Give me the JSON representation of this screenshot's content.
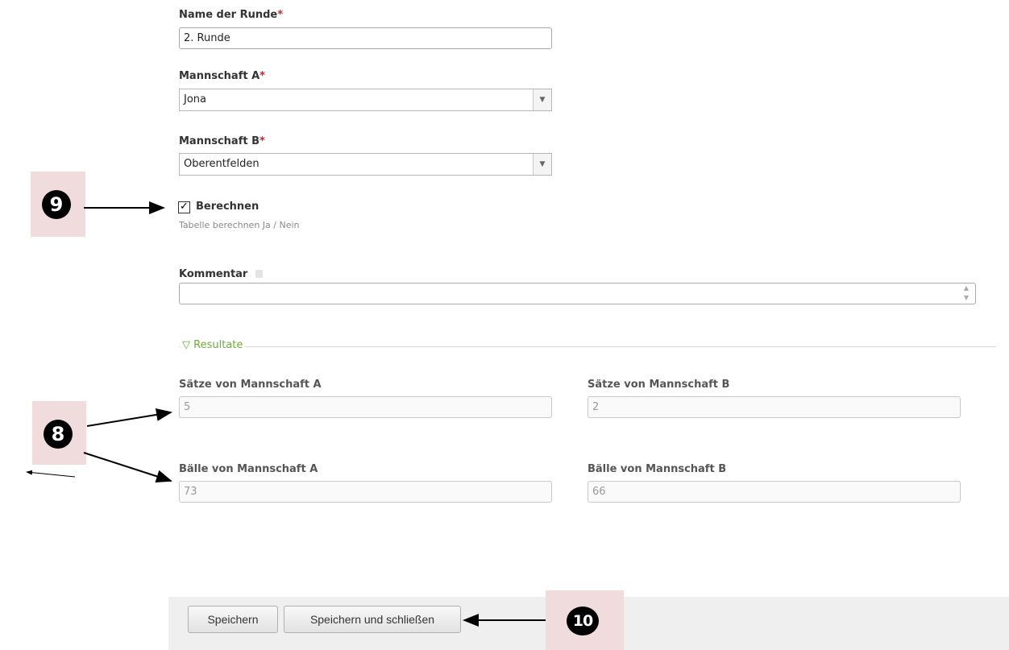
{
  "form": {
    "round_name": {
      "label": "Name der Runde",
      "required": "*",
      "value": "2. Runde"
    },
    "team_a": {
      "label": "Mannschaft A",
      "required": "*",
      "value": "Jona"
    },
    "team_b": {
      "label": "Mannschaft B",
      "required": "*",
      "value": "Oberentfelden"
    },
    "calculate": {
      "label": "Berechnen",
      "checked_mark": "✓",
      "hint": "Tabelle berechnen Ja / Nein"
    },
    "comment": {
      "label": "Kommentar",
      "value": ""
    }
  },
  "results": {
    "legend": "▽ Resultate",
    "sets_a": {
      "label": "Sätze von Mannschaft A",
      "value": "5"
    },
    "sets_b": {
      "label": "Sätze von Mannschaft B",
      "value": "2"
    },
    "balls_a": {
      "label": "Bälle von Mannschaft A",
      "value": "73"
    },
    "balls_b": {
      "label": "Bälle von Mannschaft B",
      "value": "66"
    }
  },
  "footer": {
    "save": "Speichern",
    "save_close": "Speichern und schließen"
  },
  "annotations": {
    "n8": "8",
    "n9": "9",
    "n10": "10"
  },
  "icons": {
    "select_arrow": "dropdown-arrow-icon",
    "comment_icon": "translate-icon",
    "spinner": "spinner-icon"
  },
  "colors": {
    "required": "#d0202a",
    "legend": "#6fae3d",
    "badge_bg": "#f0dcdc",
    "footer_bg": "#efefef"
  }
}
